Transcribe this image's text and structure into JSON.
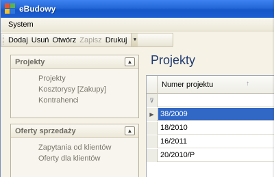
{
  "window": {
    "title": "eBudowy",
    "icon": "app-logo-icon"
  },
  "menu": {
    "items": [
      {
        "label": "System"
      }
    ]
  },
  "toolbar": {
    "buttons": [
      {
        "label": "Dodaj",
        "enabled": true
      },
      {
        "label": "Usuń",
        "enabled": true
      },
      {
        "label": "Otwórz",
        "enabled": true
      },
      {
        "label": "Zapisz",
        "enabled": false
      },
      {
        "label": "Drukuj",
        "enabled": true
      }
    ],
    "overflow_icon": "chevron-down-icon"
  },
  "sidebar": {
    "panels": [
      {
        "title": "Projekty",
        "collapse_icon": "chevron-up-icon",
        "links": [
          "Projekty",
          "Kosztorysy [Zakupy]",
          "Kontrahenci"
        ]
      },
      {
        "title": "Oferty sprzedaży",
        "collapse_icon": "chevron-up-icon",
        "links": [
          "Zapytania od klientów",
          "Oferty dla klientów"
        ]
      }
    ]
  },
  "main": {
    "title": "Projekty",
    "grid": {
      "column": "Numer projektu",
      "sort_icon": "sort-ascending-icon",
      "filter_icon": "filter-icon",
      "rows": [
        "38/2009",
        "18/2010",
        "16/2011",
        "20/2010/P"
      ],
      "selected_index": 0,
      "current_row_icon": "row-pointer-icon"
    }
  },
  "colors": {
    "titlebar": "#2468d8",
    "selection": "#3168c6",
    "section_title": "#1f3a70"
  }
}
